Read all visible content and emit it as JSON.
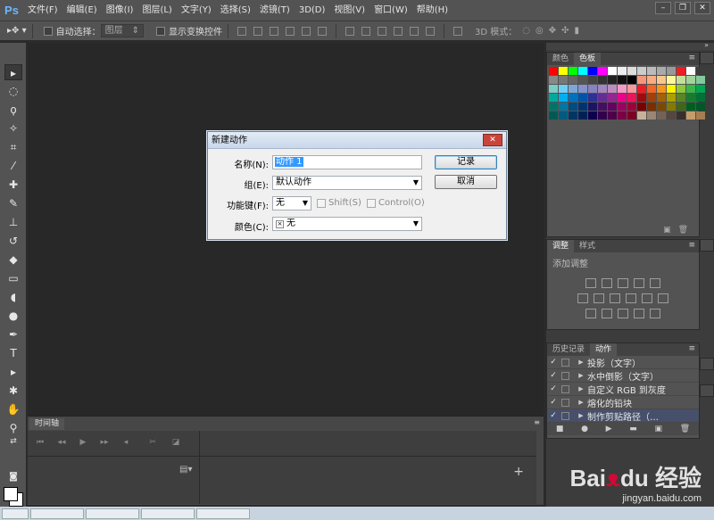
{
  "app": {
    "logo": "Ps"
  },
  "menu": [
    "文件(F)",
    "编辑(E)",
    "图像(I)",
    "图层(L)",
    "文字(Y)",
    "选择(S)",
    "滤镜(T)",
    "3D(D)",
    "视图(V)",
    "窗口(W)",
    "帮助(H)"
  ],
  "window_controls": {
    "minimize": "–",
    "restore": "❐",
    "close": "✕"
  },
  "options": {
    "auto_select_label": "自动选择：",
    "auto_select_value": "图层",
    "show_transform_label": "显示变换控件",
    "mode_3d_label": "3D 模式："
  },
  "swatches_panel": {
    "tabs": [
      "颜色",
      "色板"
    ],
    "active_tab": "色板",
    "colors": [
      "#ff0000",
      "#ffff00",
      "#00ff00",
      "#00ffff",
      "#0000ff",
      "#ff00ff",
      "#ffffff",
      "#eeeeee",
      "#dddddd",
      "#cccccc",
      "#bbbbbb",
      "#aaaaaa",
      "#999999",
      "#ee1c24",
      "#ffffff",
      "#3c3c3c",
      "#888888",
      "#777777",
      "#666666",
      "#555555",
      "#444444",
      "#333333",
      "#222222",
      "#111111",
      "#000000",
      "#f7977a",
      "#f9ad81",
      "#fdc68a",
      "#fff79a",
      "#c4df9b",
      "#a3d39c",
      "#82ca9d",
      "#7bcdc8",
      "#6ecff6",
      "#7ea7d8",
      "#8493ca",
      "#8882be",
      "#a187be",
      "#bc8dbf",
      "#f49ac2",
      "#f6989d",
      "#ed1c24",
      "#f26522",
      "#f7941d",
      "#fff200",
      "#8dc73f",
      "#39b54a",
      "#00a651",
      "#00a99d",
      "#00aeef",
      "#0072bc",
      "#0054a6",
      "#2e3192",
      "#662d91",
      "#92278f",
      "#ec008c",
      "#ed145b",
      "#9e0b0f",
      "#a0410d",
      "#a36209",
      "#aba000",
      "#598527",
      "#1a7b30",
      "#007236",
      "#00746b",
      "#0076a3",
      "#004b80",
      "#003471",
      "#1b1464",
      "#440e62",
      "#630460",
      "#9e005d",
      "#9e0039",
      "#790000",
      "#7b2e00",
      "#7d4900",
      "#827b00",
      "#406618",
      "#005e20",
      "#005826",
      "#005952",
      "#005b7f",
      "#003663",
      "#002157",
      "#0d004c",
      "#32004b",
      "#4b0049",
      "#7b0046",
      "#7a0026",
      "#c7b299",
      "#998675",
      "#736357",
      "#534741",
      "#37302d",
      "#c69c6d",
      "#a67c52"
    ]
  },
  "adjustments_panel": {
    "tabs": [
      "调整",
      "样式"
    ],
    "active_tab": "调整",
    "title": "添加调整"
  },
  "actions_panel": {
    "tabs": [
      "历史记录",
      "动作"
    ],
    "active_tab": "动作",
    "items": [
      {
        "check": "✓",
        "label": "投影（文字）",
        "selected": false
      },
      {
        "check": "✓",
        "label": "水中倒影（文字）",
        "selected": false
      },
      {
        "check": "✓",
        "label": "自定义 RGB 到灰度",
        "selected": false
      },
      {
        "check": "✓",
        "label": "熔化的铅块",
        "selected": false
      },
      {
        "check": "✓",
        "label": "制作剪贴路径（…",
        "selected": true
      }
    ]
  },
  "timeline": {
    "tab": "时间轴",
    "add": "+"
  },
  "dialog": {
    "title": "新建动作",
    "close": "✕",
    "name_label": "名称(N):",
    "name_value": "动作 1",
    "group_label": "组(E):",
    "group_value": "默认动作",
    "fkey_label": "功能键(F):",
    "fkey_value": "无",
    "shift_label": "Shift(S)",
    "control_label": "Control(O)",
    "color_label": "颜色(C):",
    "color_value": "无",
    "record_button": "记录",
    "cancel_button": "取消"
  },
  "watermark": {
    "logo": "Bai",
    "paw": "ᴥ",
    "logo_suffix": "du 经验",
    "url": "jingyan.baidu.com"
  }
}
